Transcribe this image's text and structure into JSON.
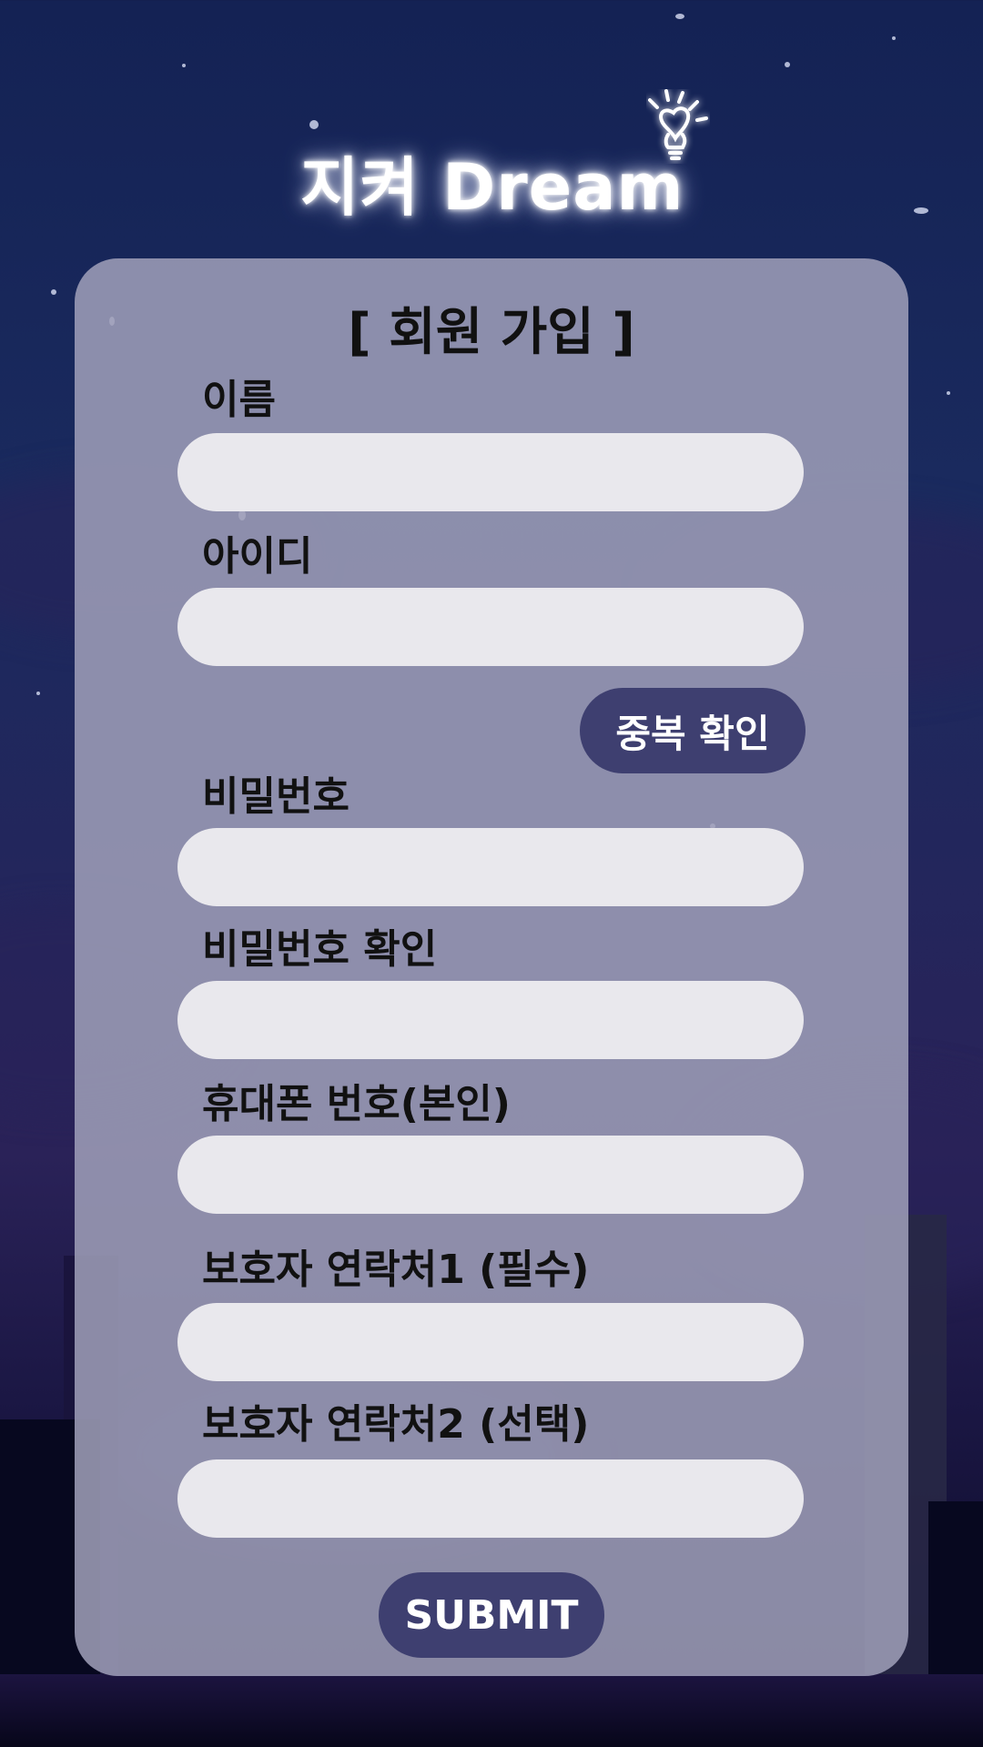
{
  "app": {
    "logo_text": "지켜 Dream"
  },
  "form": {
    "title": "[ 회원 가입 ]",
    "fields": [
      {
        "label": "이름",
        "value": "",
        "placeholder": ""
      },
      {
        "label": "아이디",
        "value": "",
        "placeholder": ""
      },
      {
        "label": "비밀번호",
        "value": "",
        "placeholder": ""
      },
      {
        "label": "비밀번호 확인",
        "value": "",
        "placeholder": ""
      },
      {
        "label": "휴대폰 번호(본인)",
        "value": "",
        "placeholder": ""
      },
      {
        "label": "보호자 연락처1 (필수)",
        "value": "",
        "placeholder": ""
      },
      {
        "label": "보호자 연락처2 (선택)",
        "value": "",
        "placeholder": ""
      }
    ],
    "duplicate_check_label": "중복 확인",
    "submit_label": "SUBMIT"
  },
  "icons": {
    "logo_icon": "lightbulb-heart-icon"
  },
  "colors": {
    "card_bg": "#a0a0b9",
    "input_bg": "#e9e8ed",
    "button_bg": "#3e3f70",
    "button_text": "#ffffff",
    "label_text": "#111111",
    "background_top": "#142254",
    "background_bottom": "#0b0a26"
  }
}
